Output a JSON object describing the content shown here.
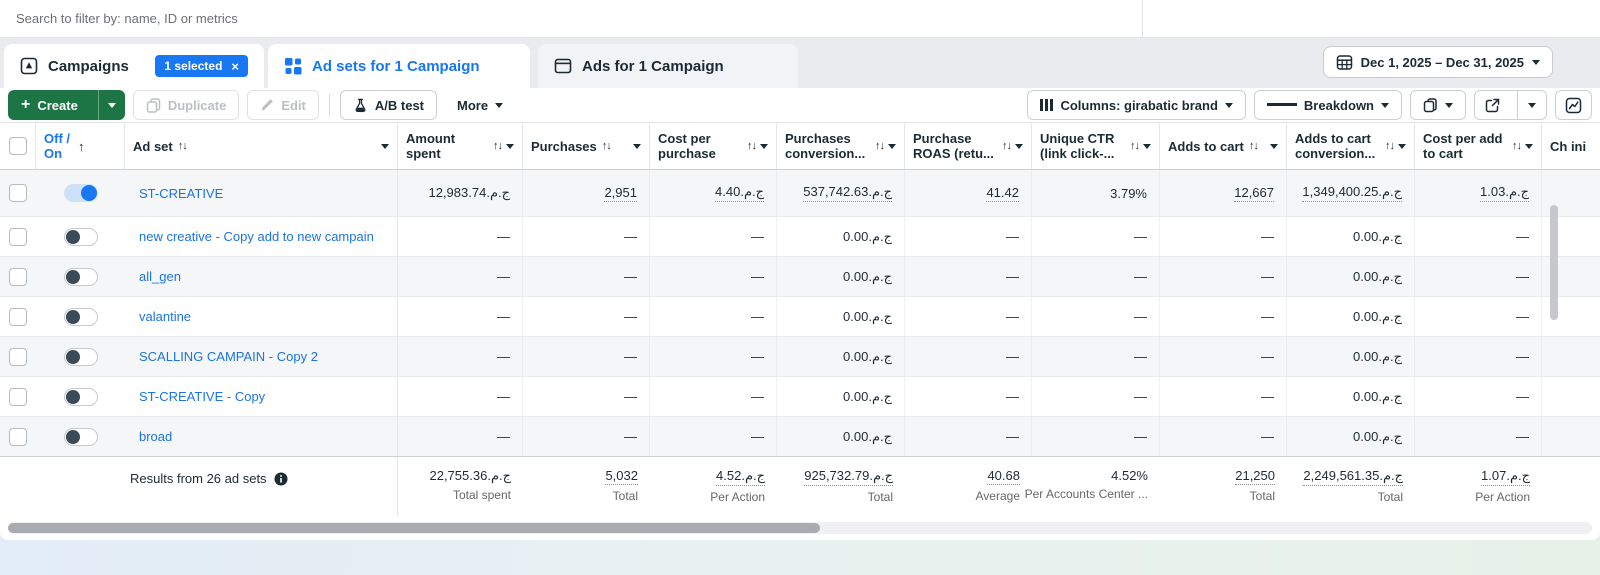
{
  "colors": {
    "accent_blue": "#1877f2",
    "link_blue": "#1b74e4",
    "create_green": "#1d7444",
    "text_dark": "#1c2b33",
    "text_gray": "#65676b"
  },
  "search": {
    "placeholder": "Search to filter by: name, ID or metrics"
  },
  "tabs": {
    "campaigns": {
      "label": "Campaigns",
      "badge": "1 selected",
      "close": "×"
    },
    "adsets": {
      "label": "Ad sets for 1 Campaign"
    },
    "ads": {
      "label": "Ads for 1 Campaign"
    }
  },
  "date_range": {
    "label": "Dec 1, 2025 – Dec 31, 2025"
  },
  "toolbar": {
    "create": "Create",
    "duplicate": "Duplicate",
    "edit": "Edit",
    "ab_test": "A/B test",
    "more": "More",
    "columns": "Columns: girabatic brand",
    "breakdown": "Breakdown"
  },
  "table": {
    "header": {
      "off_on_1": "Off /",
      "off_on_2": "On",
      "sort_asc": "↑",
      "sort_both": "↑↓",
      "ad_set": "Ad set",
      "metrics": [
        {
          "label": "Amount spent",
          "sort": "right"
        },
        {
          "label": "Purchases",
          "sort": "inline"
        },
        {
          "label": "Cost per purchase",
          "sort": "right"
        },
        {
          "label": "Purchases conversion...",
          "sort": "right"
        },
        {
          "label": "Purchase ROAS (retu...",
          "sort": "right"
        },
        {
          "label": "Unique CTR (link click-...",
          "sort": "right"
        },
        {
          "label": "Adds to cart",
          "sort": "inline"
        },
        {
          "label": "Adds to cart conversion...",
          "sort": "right"
        },
        {
          "label": "Cost per add to cart",
          "sort": "right"
        },
        {
          "label": "Ch ini",
          "sort": "none"
        }
      ]
    },
    "rows": [
      {
        "name": "ST-CREATIVE",
        "on": true,
        "cells": [
          "12,983.74⁧ج.م.⁩",
          "2,951",
          "4.40⁧ج.م.⁩",
          "537,742.63⁧ج.م.⁩",
          "41.42",
          "3.79%",
          "12,667",
          "1,349,400.25⁧ج.م.⁩",
          "1.03⁧ج.م.⁩"
        ],
        "linked": [
          false,
          true,
          true,
          true,
          true,
          false,
          true,
          true,
          true
        ]
      },
      {
        "name": "new creative - Copy add to new campain",
        "on": false,
        "cells": [
          "—",
          "—",
          "—",
          "0.00⁧ج.م.⁩",
          "—",
          "—",
          "—",
          "0.00⁧ج.م.⁩",
          "—"
        ]
      },
      {
        "name": "all_gen",
        "on": false,
        "cells": [
          "—",
          "—",
          "—",
          "0.00⁧ج.م.⁩",
          "—",
          "—",
          "—",
          "0.00⁧ج.م.⁩",
          "—"
        ]
      },
      {
        "name": "valantine",
        "on": false,
        "cells": [
          "—",
          "—",
          "—",
          "0.00⁧ج.م.⁩",
          "—",
          "—",
          "—",
          "0.00⁧ج.م.⁩",
          "—"
        ]
      },
      {
        "name": "SCALLING CAMPAIN - Copy 2",
        "on": false,
        "cells": [
          "—",
          "—",
          "—",
          "0.00⁧ج.م.⁩",
          "—",
          "—",
          "—",
          "0.00⁧ج.م.⁩",
          "—"
        ]
      },
      {
        "name": "ST-CREATIVE - Copy",
        "on": false,
        "cells": [
          "—",
          "—",
          "—",
          "0.00⁧ج.م.⁩",
          "—",
          "—",
          "—",
          "0.00⁧ج.م.⁩",
          "—"
        ]
      },
      {
        "name": "broad",
        "on": false,
        "cells": [
          "—",
          "—",
          "—",
          "0.00⁧ج.م.⁩",
          "—",
          "—",
          "—",
          "0.00⁧ج.م.⁩",
          "—"
        ]
      }
    ],
    "footer": {
      "results": "Results from 26 ad sets",
      "cells": [
        {
          "value": "22,755.36⁧ج.م.⁩",
          "label": "Total spent",
          "u": false
        },
        {
          "value": "5,032",
          "label": "Total",
          "u": true
        },
        {
          "value": "4.52⁧ج.م.⁩",
          "label": "Per Action",
          "u": true
        },
        {
          "value": "925,732.79⁧ج.م.⁩",
          "label": "Total",
          "u": true
        },
        {
          "value": "40.68",
          "label": "Average",
          "u": true
        },
        {
          "value": "4.52%",
          "label": "Per Accounts Center ...",
          "u": false
        },
        {
          "value": "21,250",
          "label": "Total",
          "u": true
        },
        {
          "value": "2,249,561.35⁧ج.م.⁩",
          "label": "Total",
          "u": true
        },
        {
          "value": "1.07⁧ج.م.⁩",
          "label": "Per Action",
          "u": true
        }
      ]
    }
  }
}
